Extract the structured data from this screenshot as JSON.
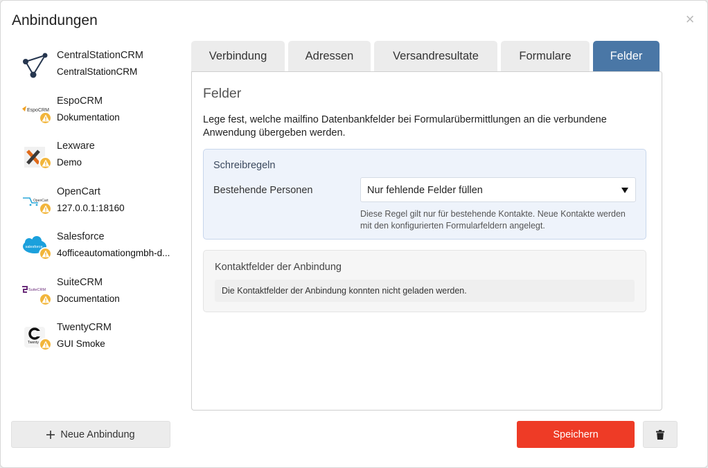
{
  "dialog": {
    "title": "Anbindungen",
    "close_symbol": "×"
  },
  "sidebar": {
    "items": [
      {
        "name": "CentralStationCRM",
        "sub": "CentralStationCRM",
        "warning": false,
        "logo": "centralstation-logo"
      },
      {
        "name": "EspoCRM",
        "sub": "Dokumentation",
        "warning": true,
        "logo": "espocrm-logo",
        "logo_text": "EspoCRM"
      },
      {
        "name": "Lexware",
        "sub": "Demo",
        "warning": true,
        "logo": "lexware-logo"
      },
      {
        "name": "OpenCart",
        "sub": "127.0.0.1:18160",
        "warning": true,
        "logo": "opencart-logo",
        "logo_text": "OpenCart"
      },
      {
        "name": "Salesforce",
        "sub": "4officeautomationgmbh-d...",
        "warning": true,
        "logo": "salesforce-logo",
        "logo_text": "salesforce"
      },
      {
        "name": "SuiteCRM",
        "sub": "Documentation",
        "warning": true,
        "logo": "suitecrm-logo",
        "logo_text": "SuiteCRM"
      },
      {
        "name": "TwentyCRM",
        "sub": "GUI Smoke",
        "warning": true,
        "logo": "twentycrm-logo",
        "logo_text": "Twenty"
      }
    ]
  },
  "tabs": [
    {
      "label": "Verbindung",
      "active": false
    },
    {
      "label": "Adressen",
      "active": false
    },
    {
      "label": "Versandresultate",
      "active": false
    },
    {
      "label": "Formulare",
      "active": false
    },
    {
      "label": "Felder",
      "active": true
    }
  ],
  "panel": {
    "title": "Felder",
    "description": "Lege fest, welche mailfino Datenbankfelder bei Formularübermittlungen an die verbundene Anwendung übergeben werden.",
    "rules": {
      "title": "Schreibregeln",
      "label": "Bestehende Personen",
      "select_value": "Nur fehlende Felder füllen",
      "help": "Diese Regel gilt nur für bestehende Kontakte. Neue Kontakte werden mit den konfigurierten Formularfeldern angelegt."
    },
    "contact_fields": {
      "title": "Kontaktfelder der Anbindung",
      "message": "Die Kontaktfelder der Anbindung konnten nicht geladen werden."
    }
  },
  "footer": {
    "new_label": "Neue Anbindung",
    "new_icon": "plus-icon",
    "save_label": "Speichern",
    "delete_icon": "trash-icon"
  },
  "colors": {
    "accent": "#4a77a6",
    "save": "#ee3b26",
    "warning": "#f2b53a"
  }
}
